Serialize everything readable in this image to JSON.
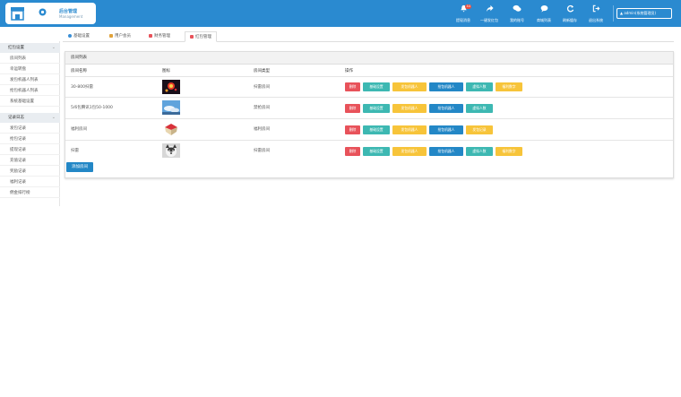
{
  "header": {
    "title": "后台管理",
    "subtitle": "Management",
    "nav": [
      {
        "label": "提现消息",
        "icon": "bell-icon",
        "badge": "44"
      },
      {
        "label": "一键发红包",
        "icon": "share-icon"
      },
      {
        "label": "我的账号",
        "icon": "chat-icon"
      },
      {
        "label": "商城列表",
        "icon": "comment-icon"
      },
      {
        "label": "刷新缓存",
        "icon": "refresh-icon"
      },
      {
        "label": "退出系统",
        "icon": "logout-icon"
      }
    ],
    "user": "admin(系统管理员)"
  },
  "tabs": [
    {
      "label": "基础设置",
      "icon_color": "#3a8fd6"
    },
    {
      "label": "用户会员",
      "icon_color": "#e0a23a"
    },
    {
      "label": "财务管理",
      "icon_color": "#e8525a"
    },
    {
      "label": "红包管理",
      "icon_color": "#e8525a"
    }
  ],
  "sidebar": {
    "groups": [
      {
        "label": "红包设置",
        "items": [
          "房间列表",
          "幸运转盘",
          "发包机器人列表",
          "抢包机器人列表",
          "系统基础设置"
        ]
      },
      {
        "label": "记录日志",
        "items": [
          "发包记录",
          "抢包记录",
          "提现记录",
          "充值记录",
          "奖励记录",
          "福利记录",
          "佣金排行榜"
        ]
      }
    ]
  },
  "panel": {
    "title": "房间列表",
    "columns": [
      "房间名称",
      "图标",
      "房间类型",
      "操作"
    ],
    "rows": [
      {
        "name": "30-800扫雷",
        "type": "扫雷房间",
        "image": "fireworks-image",
        "actions": [
          {
            "label": "删除",
            "style": "red"
          },
          {
            "label": "基础设置",
            "style": "teal"
          },
          {
            "label": "发包机器人",
            "style": "yellow"
          },
          {
            "label": "抢包机器人",
            "style": "blue"
          },
          {
            "label": "虚拟人数",
            "style": "teal"
          },
          {
            "label": "福利数字",
            "style": "yellow"
          }
        ]
      },
      {
        "name": "5/6包腾讯1包50-1000",
        "type": "禁抢房间",
        "image": "sky-image",
        "actions": [
          {
            "label": "删除",
            "style": "red"
          },
          {
            "label": "基础设置",
            "style": "teal"
          },
          {
            "label": "发包机器人",
            "style": "yellow"
          },
          {
            "label": "抢包机器人",
            "style": "blue"
          },
          {
            "label": "虚拟人数",
            "style": "teal"
          }
        ]
      },
      {
        "name": "福利房间",
        "type": "福利房间",
        "image": "gift-image",
        "actions": [
          {
            "label": "删除",
            "style": "red"
          },
          {
            "label": "基础设置",
            "style": "teal"
          },
          {
            "label": "发包机器人",
            "style": "yellow"
          },
          {
            "label": "抢包机器人",
            "style": "blue"
          },
          {
            "label": "发包记录",
            "style": "yellow"
          }
        ]
      },
      {
        "name": "扫雷",
        "type": "扫雷房间",
        "image": "dog-image",
        "actions": [
          {
            "label": "删除",
            "style": "red"
          },
          {
            "label": "基础设置",
            "style": "teal"
          },
          {
            "label": "发包机器人",
            "style": "yellow"
          },
          {
            "label": "抢包机器人",
            "style": "blue"
          },
          {
            "label": "虚拟人数",
            "style": "teal"
          },
          {
            "label": "福利数字",
            "style": "yellow"
          }
        ]
      }
    ],
    "add_label": "添加房间"
  }
}
